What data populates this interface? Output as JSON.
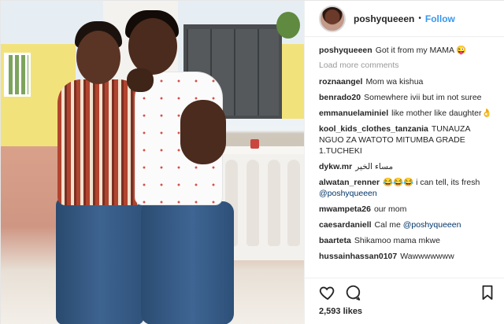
{
  "header": {
    "username": "poshyqueeen",
    "separator": "•",
    "follow_label": "Follow"
  },
  "caption": {
    "username": "poshyqueeen",
    "text": "Got it from my MAMA 😜"
  },
  "load_more_label": "Load more comments",
  "comments": [
    {
      "user": "roznaangel",
      "text": "Mom wa kishua"
    },
    {
      "user": "benrado20",
      "text": "Somewhere ivii but im not suree"
    },
    {
      "user": "emmanuelaminiel",
      "text": "like mother like daughter👌"
    },
    {
      "user": "kool_kids_clothes_tanzania",
      "text": "TUNAUZA NGUO ZA WATOTO MITUMBA GRADE 1.TUCHEKI"
    },
    {
      "user": "dykw.mr",
      "text": "مساء الخير"
    },
    {
      "user": "alwatan_renner",
      "text": "😂😂😂 i can tell, its fresh",
      "mention": "@poshyqueeen"
    },
    {
      "user": "mwampeta26",
      "text": "our mom"
    },
    {
      "user": "caesardaniell",
      "text": "Cal me",
      "mention": "@poshyqueeen"
    },
    {
      "user": "baarteta",
      "text": "Shikamoo mama mkwe"
    },
    {
      "user": "hussainhassan0107",
      "text": "Wawwwwwww"
    }
  ],
  "actions": {
    "like_icon": "heart-icon",
    "comment_icon": "comment-icon",
    "save_icon": "bookmark-icon"
  },
  "likes_text": "2,593 likes",
  "colors": {
    "accent": "#3897f0",
    "text": "#262626",
    "muted": "#999999"
  }
}
